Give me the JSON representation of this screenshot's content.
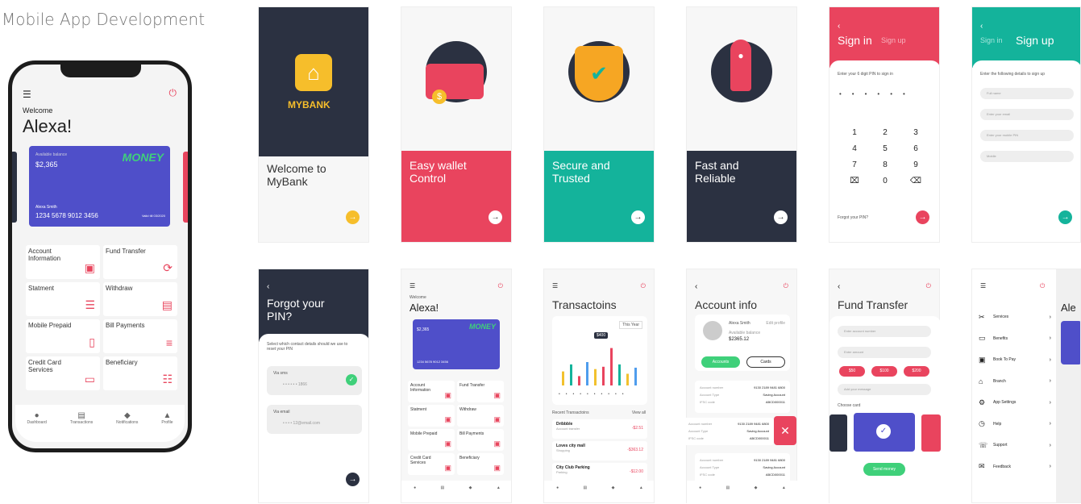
{
  "title": "Mobile App Development",
  "phone": {
    "welcome": "Welcome",
    "name": "Alexa!",
    "balance_label": "Available balance",
    "balance": "$2,365",
    "brand": "MONEY",
    "card_name": "Alexa Smith",
    "card_number": "1234 5678 9012 3456",
    "card_valid": "Valid till 03/2020",
    "tiles": [
      {
        "label": "Account Information",
        "icon": "wallet-icon"
      },
      {
        "label": "Fund Transfer",
        "icon": "transfer-icon"
      },
      {
        "label": "Statment",
        "icon": "statement-icon"
      },
      {
        "label": "Withdraw",
        "icon": "atm-icon"
      },
      {
        "label": "Mobile Prepaid",
        "icon": "mobile-icon"
      },
      {
        "label": "Bill Payments",
        "icon": "bill-icon"
      },
      {
        "label": "Credit Card Services",
        "icon": "card-icon"
      },
      {
        "label": "Beneficiary",
        "icon": "contact-icon"
      }
    ],
    "nav": [
      "Dashboard",
      "Transactions",
      "Notifications",
      "Profile"
    ]
  },
  "onboard": [
    {
      "title": "Welcome to MyBank",
      "logo": "MYBANK"
    },
    {
      "title": "Easy wallet Control"
    },
    {
      "title": "Secure and Trusted"
    },
    {
      "title": "Fast and Reliable"
    }
  ],
  "signin": {
    "title": "Sign in",
    "alt": "Sign up",
    "prompt": "Enter your 6 digit PIN to sign in",
    "keys": [
      "1",
      "2",
      "3",
      "4",
      "5",
      "6",
      "7",
      "8",
      "9",
      "⌧",
      "0",
      "⌫"
    ],
    "forgot": "Forgot your PIN?"
  },
  "signup": {
    "alt": "Sign in",
    "title": "Sign up",
    "prompt": "Enter the following details to sign up",
    "fields": [
      "Full name",
      "Enter your email",
      "Enter your mobile PIN",
      "Mobile"
    ]
  },
  "forgot": {
    "title": "Forgot your PIN?",
    "desc": "Select which contact details should we use to reset your PIN",
    "via_sms": "Via sms",
    "sms_value": "• • • • • • 1866",
    "via_email": "Via email",
    "email_value": "• • • • 12@email.com"
  },
  "dashboard2": {
    "welcome": "Welcome",
    "name": "Alexa!",
    "balance": "$2,365",
    "number": "1234 5678 9012 3456",
    "money": "MONEY",
    "tiles": [
      "Account Information",
      "Fund Transfer",
      "Statment",
      "Withdraw",
      "Mobile Prepaid",
      "Bill Payments",
      "Credit Card Services",
      "Beneficiary"
    ]
  },
  "transactions": {
    "title": "Transactoins",
    "period": "This Year",
    "badge": "$400",
    "recent": "Recent Transactoins",
    "viewall": "View all",
    "items": [
      {
        "name": "Dribbble",
        "sub": "Account transfer",
        "amt": "-$2.51"
      },
      {
        "name": "Loves city mall",
        "sub": "Shopping",
        "amt": "-$363.12"
      },
      {
        "name": "City Club Parking",
        "sub": "Parking",
        "amt": "-$12.00"
      }
    ],
    "bars": [
      {
        "v": 30,
        "c": "#f2c12e"
      },
      {
        "v": 45,
        "c": "#14b39b"
      },
      {
        "v": 20,
        "c": "#e9445e"
      },
      {
        "v": 50,
        "c": "#4f9ded"
      },
      {
        "v": 35,
        "c": "#f2c12e"
      },
      {
        "v": 40,
        "c": "#e9445e"
      },
      {
        "v": 80,
        "c": "#e9445e"
      },
      {
        "v": 45,
        "c": "#14b39b"
      },
      {
        "v": 25,
        "c": "#f2c12e"
      },
      {
        "v": 38,
        "c": "#4f9ded"
      }
    ]
  },
  "account": {
    "title": "Account info",
    "name": "Alexa Smith",
    "edit": "Edit profile",
    "bal_label": "Available balance",
    "balance": "$2365.12",
    "tab1": "Accounts",
    "tab2": "Cards",
    "rows": [
      [
        "Account number",
        "9130 2189 9481 6800"
      ],
      [
        "Account Type",
        "Saving Account"
      ],
      [
        "IFSC code",
        "ABCD000011"
      ]
    ]
  },
  "fund": {
    "title": "Fund Transfer",
    "f1": "Enter account number",
    "f2": "Enter amount",
    "chips": [
      "$50",
      "$100",
      "$200"
    ],
    "f3": "Add your message",
    "choose": "Choose card",
    "send": "Send money"
  },
  "menu": {
    "items": [
      "Services",
      "Benefits",
      "Book To Pay",
      "Branch",
      "App Settings",
      "Help",
      "Support",
      "Feedback"
    ]
  }
}
